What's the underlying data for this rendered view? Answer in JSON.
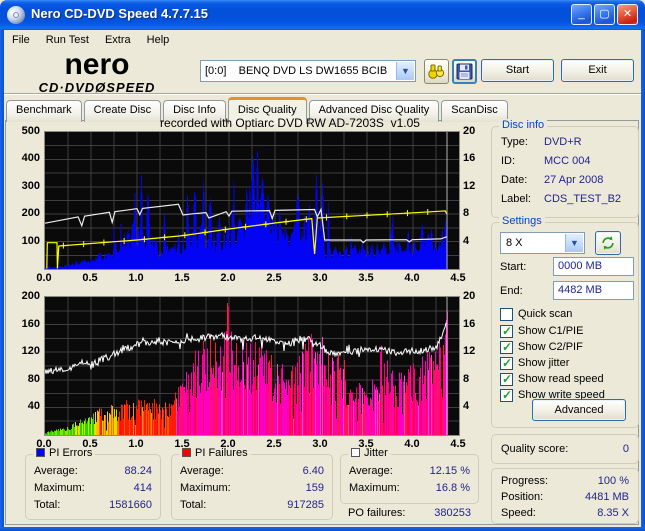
{
  "window": {
    "title": "Nero CD-DVD Speed 4.7.7.15"
  },
  "menu": {
    "items": [
      "File",
      "Run Test",
      "Extra",
      "Help"
    ]
  },
  "toolbar": {
    "logo_top": "nero",
    "logo_bottom": "CD·DVDØSPEED",
    "drive_select": "[0:0]    BENQ DVD LS DW1655 BCIB",
    "start_label": "Start",
    "exit_label": "Exit"
  },
  "tabs": {
    "items": [
      "Benchmark",
      "Create Disc",
      "Disc Info",
      "Disc Quality",
      "Advanced Disc Quality",
      "ScanDisc"
    ],
    "active_index": 3
  },
  "chart_header": "recorded with Optiarc DVD RW AD-7203S  v1.05",
  "disc_info": {
    "caption": "Disc info",
    "rows": [
      {
        "label": "Type:",
        "value": "DVD+R"
      },
      {
        "label": "ID:",
        "value": "MCC 004"
      },
      {
        "label": "Date:",
        "value": "27 Apr 2008"
      },
      {
        "label": "Label:",
        "value": "CDS_TEST_B2"
      }
    ]
  },
  "settings": {
    "caption": "Settings",
    "speed_value": "8 X",
    "start_label": "Start:",
    "start_value": "0000 MB",
    "end_label": "End:",
    "end_value": "4482 MB",
    "checkboxes": [
      {
        "label": "Quick scan",
        "checked": false
      },
      {
        "label": "Show C1/PIE",
        "checked": true
      },
      {
        "label": "Show C2/PIF",
        "checked": true
      },
      {
        "label": "Show jitter",
        "checked": true
      },
      {
        "label": "Show read speed",
        "checked": true
      },
      {
        "label": "Show write speed",
        "checked": true
      }
    ],
    "advanced_label": "Advanced"
  },
  "quality": {
    "label": "Quality score:",
    "value": "0"
  },
  "progress": {
    "rows": [
      {
        "label": "Progress:",
        "value": "100 %"
      },
      {
        "label": "Position:",
        "value": "4481 MB"
      },
      {
        "label": "Speed:",
        "value": "8.35 X"
      }
    ]
  },
  "stats": {
    "pi_errors": {
      "caption": "PI Errors",
      "swatch": "#0404f4",
      "rows": [
        {
          "label": "Average:",
          "value": "88.24"
        },
        {
          "label": "Maximum:",
          "value": "414"
        },
        {
          "label": "Total:",
          "value": "1581660"
        }
      ]
    },
    "pi_failures": {
      "caption": "PI Failures",
      "swatch": "#f40404",
      "rows": [
        {
          "label": "Average:",
          "value": "6.40"
        },
        {
          "label": "Maximum:",
          "value": "159"
        },
        {
          "label": "Total:",
          "value": "917285"
        }
      ]
    },
    "jitter": {
      "caption": "Jitter",
      "swatch": "#ffffff",
      "rows": [
        {
          "label": "Average:",
          "value": "12.15 %"
        },
        {
          "label": "Maximum:",
          "value": "16.8 %"
        }
      ],
      "po_label": "PO failures:",
      "po_value": "380253"
    }
  },
  "chart_data": [
    {
      "id": "pi_errors_chart",
      "type": "area",
      "title": "recorded with Optiarc DVD RW AD-7203S  v1.05",
      "x_range": [
        0,
        4.5
      ],
      "x_end": 4.37,
      "x_ticks": [
        "0.0",
        "0.5",
        "1.0",
        "1.5",
        "2.0",
        "2.5",
        "3.0",
        "3.5",
        "4.0",
        "4.5"
      ],
      "left_axis": {
        "range": [
          0,
          500
        ],
        "ticks": [
          500,
          400,
          300,
          200,
          100
        ]
      },
      "right_axis": {
        "range": [
          0,
          20
        ],
        "ticks": [
          20,
          16,
          12,
          8,
          4
        ]
      },
      "grid": {
        "x_step": 0.25,
        "y_rows": 10,
        "color": "#3f3f3f"
      },
      "seed": 20080427,
      "series": [
        {
          "name": "PI Errors",
          "kind": "spiky_area",
          "axis": "left",
          "color": "#0404f4",
          "noise": [
            0.45,
            1.4
          ],
          "spike_prob": 0.05,
          "spike_gain": 1.7,
          "base": [
            [
              0,
              6
            ],
            [
              0.2,
              12
            ],
            [
              0.4,
              25
            ],
            [
              0.6,
              45
            ],
            [
              0.75,
              70
            ],
            [
              0.9,
              110
            ],
            [
              1.0,
              130
            ],
            [
              1.1,
              150
            ],
            [
              1.2,
              90
            ],
            [
              1.35,
              85
            ],
            [
              1.5,
              110
            ],
            [
              1.6,
              130
            ],
            [
              1.7,
              125
            ],
            [
              1.8,
              130
            ],
            [
              1.9,
              115
            ],
            [
              2.0,
              140
            ],
            [
              2.1,
              200
            ],
            [
              2.2,
              240
            ],
            [
              2.3,
              245
            ],
            [
              2.4,
              200
            ],
            [
              2.5,
              140
            ],
            [
              2.6,
              120
            ],
            [
              2.7,
              135
            ],
            [
              2.8,
              150
            ],
            [
              2.9,
              140
            ],
            [
              3.0,
              130
            ],
            [
              3.04,
              70
            ],
            [
              3.2,
              65
            ],
            [
              3.4,
              70
            ],
            [
              3.6,
              80
            ],
            [
              3.8,
              85
            ],
            [
              4.0,
              95
            ],
            [
              4.2,
              110
            ],
            [
              4.33,
              125
            ],
            [
              4.37,
              130
            ]
          ],
          "spikes": [
            [
              0.97,
              200
            ],
            [
              1.05,
              305
            ],
            [
              1.12,
              250
            ],
            [
              1.3,
              190
            ],
            [
              1.55,
              300
            ],
            [
              1.63,
              255
            ],
            [
              1.72,
              302
            ],
            [
              1.79,
              245
            ],
            [
              1.9,
              200
            ],
            [
              2.26,
              422
            ],
            [
              2.31,
              380
            ],
            [
              2.37,
              300
            ],
            [
              2.42,
              260
            ],
            [
              2.55,
              200
            ],
            [
              2.75,
              255
            ],
            [
              2.87,
              205
            ],
            [
              2.95,
              310
            ],
            [
              3.02,
              300
            ],
            [
              3.08,
              240
            ],
            [
              3.77,
              150
            ],
            [
              4.1,
              150
            ],
            [
              4.35,
              185
            ]
          ]
        },
        {
          "name": "Read speed",
          "kind": "line",
          "axis": "left",
          "color": "#ececec",
          "points": [
            [
              0,
              167
            ],
            [
              0.36,
              190
            ],
            [
              0.4,
              158
            ],
            [
              0.43,
              193
            ],
            [
              0.7,
              207
            ],
            [
              0.73,
              170
            ],
            [
              0.76,
              209
            ],
            [
              1.0,
              220
            ],
            [
              1.03,
              198
            ],
            [
              1.06,
              221
            ],
            [
              1.45,
              236
            ],
            [
              1.5,
              197
            ],
            [
              1.62,
              202
            ],
            [
              1.75,
              206
            ],
            [
              1.78,
              186
            ],
            [
              1.97,
              209
            ],
            [
              2.0,
              193
            ],
            [
              2.03,
              211
            ],
            [
              2.44,
              213
            ],
            [
              2.47,
              184
            ],
            [
              2.5,
              214
            ],
            [
              2.93,
              217
            ],
            [
              2.96,
              190
            ],
            [
              3.0,
              218
            ],
            [
              3.04,
              106
            ],
            [
              3.43,
              106
            ],
            [
              3.46,
              96
            ],
            [
              3.49,
              106
            ],
            [
              3.93,
              107
            ],
            [
              3.96,
              99
            ],
            [
              3.99,
              107
            ],
            [
              4.3,
              110
            ],
            [
              4.37,
              118
            ]
          ]
        },
        {
          "name": "Write speed",
          "kind": "line_markers",
          "axis": "left",
          "color": "#ffff00",
          "marker_step": 0.22,
          "points": [
            [
              0.02,
              2
            ],
            [
              0.025,
              96
            ],
            [
              0.13,
              96
            ],
            [
              0.135,
              2
            ],
            [
              0.15,
              84
            ],
            [
              0.5,
              93
            ],
            [
              1.0,
              106
            ],
            [
              1.5,
              122
            ],
            [
              2.0,
              146
            ],
            [
              2.5,
              168
            ],
            [
              2.9,
              184
            ],
            [
              2.93,
              55
            ],
            [
              2.96,
              186
            ],
            [
              3.5,
              196
            ],
            [
              4.0,
              205
            ],
            [
              4.3,
              211
            ],
            [
              4.35,
              212
            ],
            [
              4.37,
              200
            ]
          ]
        }
      ]
    },
    {
      "id": "pi_failures_chart",
      "type": "bar",
      "x_range": [
        0,
        4.5
      ],
      "x_end": 4.37,
      "x_ticks": [
        "0.0",
        "0.5",
        "1.0",
        "1.5",
        "2.0",
        "2.5",
        "3.0",
        "3.5",
        "4.0",
        "4.5"
      ],
      "left_axis": {
        "range": [
          0,
          200
        ],
        "ticks": [
          200,
          160,
          120,
          80,
          40
        ]
      },
      "right_axis": {
        "range": [
          0,
          20
        ],
        "ticks": [
          20,
          16,
          12,
          8,
          4
        ]
      },
      "grid": {
        "x_step": 0.25,
        "y_rows": 10,
        "color": "#3f3f3f"
      },
      "seed": 917285,
      "series": [
        {
          "name": "PI Failures",
          "kind": "color_bars",
          "axis": "left",
          "noise": [
            0.5,
            1.3
          ],
          "palette": [
            {
              "upto": 0.32,
              "colors": [
                "#2fd400",
                "#8fe000"
              ],
              "weights": [
                0.55,
                1
              ]
            },
            {
              "upto": 0.55,
              "colors": [
                "#2fd400",
                "#c8e400",
                "#ffd800"
              ],
              "weights": [
                0.4,
                0.8,
                1
              ]
            },
            {
              "upto": 0.8,
              "colors": [
                "#d8e000",
                "#ffc000",
                "#ff7000",
                "#ff2000"
              ],
              "weights": [
                0.35,
                0.6,
                0.85,
                1
              ]
            },
            {
              "upto": 1.42,
              "colors": [
                "#ff1c00",
                "#ff5a00",
                "#ff0040",
                "#ff9000"
              ],
              "weights": [
                0.55,
                0.8,
                0.92,
                1
              ]
            },
            {
              "upto": 9.0,
              "colors": [
                "#ff00c0",
                "#ff0060",
                "#ff1c30",
                "#ff40d0"
              ],
              "weights": [
                0.5,
                0.72,
                0.88,
                1
              ]
            }
          ],
          "base": [
            [
              0,
              4
            ],
            [
              0.15,
              7
            ],
            [
              0.25,
              10
            ],
            [
              0.35,
              16
            ],
            [
              0.45,
              22
            ],
            [
              0.55,
              28
            ],
            [
              0.65,
              33
            ],
            [
              0.72,
              38
            ],
            [
              0.78,
              30
            ],
            [
              0.82,
              38
            ],
            [
              0.9,
              42
            ],
            [
              1.0,
              42
            ],
            [
              1.1,
              40
            ],
            [
              1.2,
              42
            ],
            [
              1.3,
              36
            ],
            [
              1.4,
              48
            ],
            [
              1.5,
              65
            ],
            [
              1.6,
              90
            ],
            [
              1.7,
              110
            ],
            [
              1.8,
              115
            ],
            [
              1.9,
              125
            ],
            [
              1.98,
              150
            ],
            [
              2.02,
              125
            ],
            [
              2.1,
              112
            ],
            [
              2.2,
              108
            ],
            [
              2.3,
              112
            ],
            [
              2.4,
              105
            ],
            [
              2.5,
              88
            ],
            [
              2.6,
              78
            ],
            [
              2.7,
              82
            ],
            [
              2.8,
              95
            ],
            [
              2.85,
              112
            ],
            [
              2.95,
              115
            ],
            [
              3.0,
              112
            ],
            [
              3.1,
              88
            ],
            [
              3.2,
              92
            ],
            [
              3.3,
              78
            ],
            [
              3.4,
              62
            ],
            [
              3.5,
              55
            ],
            [
              3.6,
              75
            ],
            [
              3.65,
              108
            ],
            [
              3.7,
              90
            ],
            [
              3.8,
              65
            ],
            [
              3.9,
              75
            ],
            [
              4.0,
              80
            ],
            [
              4.1,
              88
            ],
            [
              4.15,
              100
            ],
            [
              4.25,
              95
            ],
            [
              4.3,
              115
            ],
            [
              4.34,
              150
            ],
            [
              4.37,
              150
            ]
          ],
          "spikes": [
            [
              1.72,
              130
            ],
            [
              1.98,
              185
            ],
            [
              2.9,
              135
            ],
            [
              4.35,
              162
            ]
          ]
        },
        {
          "name": "Jitter",
          "kind": "noisy_line",
          "axis": "right",
          "color": "#ffffff",
          "noise_amp": 0.5,
          "points": [
            [
              0,
              9.2
            ],
            [
              0.2,
              9.6
            ],
            [
              0.4,
              10.2
            ],
            [
              0.6,
              10.8
            ],
            [
              0.8,
              12.0
            ],
            [
              1.0,
              13.2
            ],
            [
              1.2,
              13.6
            ],
            [
              1.4,
              13.4
            ],
            [
              1.6,
              13.8
            ],
            [
              1.8,
              14.2
            ],
            [
              1.9,
              14.4
            ],
            [
              2.1,
              13.9
            ],
            [
              2.3,
              14.1
            ],
            [
              2.5,
              13.6
            ],
            [
              2.7,
              13.3
            ],
            [
              2.85,
              14.0
            ],
            [
              3.0,
              13.0
            ],
            [
              3.1,
              11.8
            ],
            [
              3.3,
              12.0
            ],
            [
              3.5,
              12.4
            ],
            [
              3.7,
              12.2
            ],
            [
              3.9,
              12.0
            ],
            [
              4.1,
              12.3
            ],
            [
              4.25,
              12.8
            ],
            [
              4.33,
              14.5
            ],
            [
              4.36,
              16.5
            ]
          ]
        }
      ]
    }
  ]
}
